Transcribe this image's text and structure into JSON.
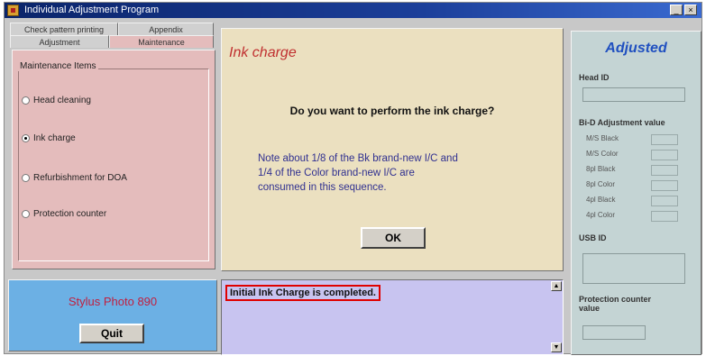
{
  "window": {
    "title": "Individual Adjustment Program",
    "minimize": "_",
    "close": "×"
  },
  "tabs": {
    "row1": [
      "Check pattern printing",
      "Appendix"
    ],
    "row2": [
      "Adjustment",
      "Maintenance"
    ]
  },
  "maintenance": {
    "group_label": "Maintenance Items",
    "items": [
      {
        "label": "Head cleaning",
        "selected": false
      },
      {
        "label": "Ink charge",
        "selected": true
      },
      {
        "label": "Refurbishment for DOA",
        "selected": false
      },
      {
        "label": "Protection counter ",
        "selected": false
      }
    ]
  },
  "model_panel": {
    "model": "Stylus Photo 890",
    "quit_label": "Quit"
  },
  "ink_charge": {
    "heading": "Ink charge",
    "question": "Do you want to perform the ink charge?",
    "note_line1": "Note about 1/8 of the Bk brand-new I/C and",
    "note_line2": "1/4 of the Color brand-new I/C are",
    "note_line3": "consumed in this sequence.",
    "ok_label": "OK"
  },
  "message": {
    "text": "Initial Ink Charge is completed."
  },
  "adjusted": {
    "title": "Adjusted",
    "head_id_label": "Head ID",
    "bi_d_label": "Bi-D Adjustment value",
    "bi_d_rows": [
      "M/S Black",
      "M/S Color",
      "8pl Black",
      "8pl Color",
      "4pl Black",
      "4pl Color"
    ],
    "usb_id_label": "USB ID",
    "protection_label_line1": "Protection counter",
    "protection_label_line2": "value"
  },
  "colors": {
    "title_bar": "#0a246a",
    "maintenance_bg": "#e4bcbc",
    "model_bg": "#6cb0e4",
    "dialog_bg": "#ebe0c0",
    "message_bg": "#c8c4f0",
    "adjusted_bg": "#c4d4d4",
    "highlight": "#e00000"
  }
}
